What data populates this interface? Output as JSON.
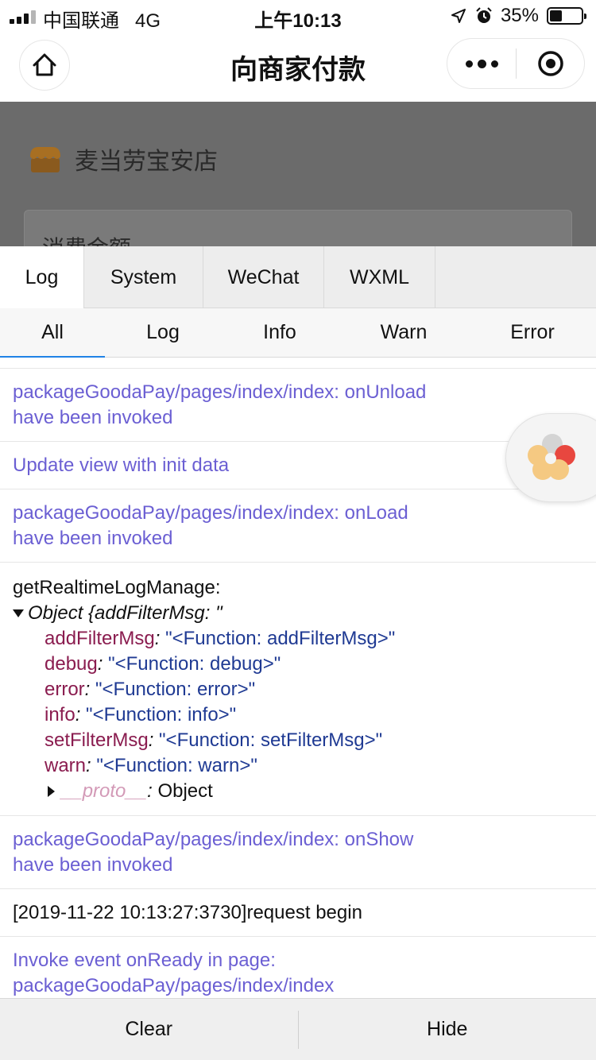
{
  "status_bar": {
    "carrier": "中国联通",
    "network": "4G",
    "time": "上午10:13",
    "battery": "35%",
    "battery_level": 0.35
  },
  "nav": {
    "title": "向商家付款",
    "home_icon": "home-icon",
    "more_icon": "more-icon",
    "close_icon": "target-icon"
  },
  "page": {
    "store_name": "麦当劳宝安店",
    "amount_label": "消费金额"
  },
  "vconsole": {
    "tabs": [
      "Log",
      "System",
      "WeChat",
      "WXML"
    ],
    "active_tab": "Log",
    "subtabs": [
      "All",
      "Log",
      "Info",
      "Warn",
      "Error"
    ],
    "active_subtab": "All",
    "logs": {
      "unload": [
        "packageGoodaPay/pages/index/index: onUnload",
        "have been invoked"
      ],
      "update_view": "Update view with init data",
      "load": [
        "packageGoodaPay/pages/index/index: onLoad",
        "have been invoked"
      ],
      "realtime": {
        "title": "getRealtimeLogManage:",
        "object_summary": "Object {addFilterMsg: \"",
        "props": [
          {
            "key": "addFilterMsg",
            "value": "\"<Function: addFilterMsg>\""
          },
          {
            "key": "debug",
            "value": "\"<Function: debug>\""
          },
          {
            "key": "error",
            "value": "\"<Function: error>\""
          },
          {
            "key": "info",
            "value": "\"<Function: info>\""
          },
          {
            "key": "setFilterMsg",
            "value": "\"<Function: setFilterMsg>\""
          },
          {
            "key": "warn",
            "value": "\"<Function: warn>\""
          }
        ],
        "proto_key": "__proto__",
        "proto_value": "Object"
      },
      "show": [
        "packageGoodaPay/pages/index/index: onShow",
        "have been invoked"
      ],
      "request": "[2019-11-22 10:13:27:3730]request begin",
      "ready": [
        "Invoke event onReady in page:",
        "packageGoodaPay/pages/index/index"
      ]
    },
    "buttons": {
      "clear": "Clear",
      "hide": "Hide"
    }
  },
  "colors": {
    "info_text": "#6b5fd3",
    "key": "#8a1c4f",
    "value": "#1f3a93",
    "active_underline": "#1f82e6"
  }
}
